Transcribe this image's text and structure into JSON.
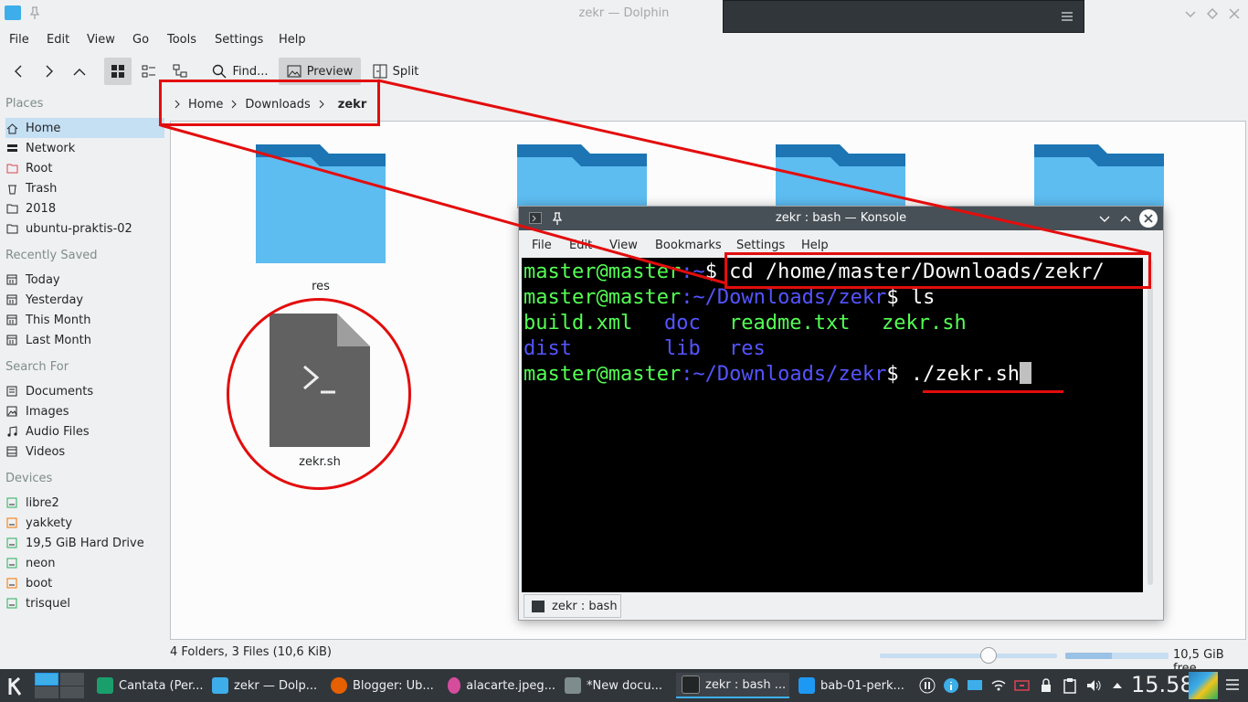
{
  "window": {
    "title": "zekr — Dolphin"
  },
  "menu": [
    "File",
    "Edit",
    "View",
    "Go",
    "Tools",
    "Settings",
    "Help"
  ],
  "toolbar": {
    "find": "Find...",
    "preview": "Preview",
    "split": "Split"
  },
  "breadcrumb": [
    "Home",
    "Downloads",
    "zekr"
  ],
  "places": {
    "header": "Places",
    "items": [
      "Home",
      "Network",
      "Root",
      "Trash",
      "2018",
      "ubuntu-praktis-02"
    ],
    "recent_header": "Recently Saved",
    "recent": [
      "Today",
      "Yesterday",
      "This Month",
      "Last Month"
    ],
    "search_header": "Search For",
    "search": [
      "Documents",
      "Images",
      "Audio Files",
      "Videos"
    ],
    "devices_header": "Devices",
    "devices": [
      "libre2",
      "yakkety",
      "19,5 GiB Hard Drive",
      "neon",
      "boot",
      "trisquel"
    ]
  },
  "files": {
    "res": "res",
    "zekr": "zekr.sh"
  },
  "status": {
    "summary": "4 Folders, 3 Files (10,6 KiB)",
    "free": "10,5 GiB free"
  },
  "konsole": {
    "title": "zekr : bash — Konsole",
    "menu": [
      "File",
      "Edit",
      "View",
      "Bookmarks",
      "Settings",
      "Help"
    ],
    "prompt_user": "master@master",
    "line1_path": ":~",
    "line1_cmd": "$ cd /home/master/Downloads/zekr/",
    "line2_path": ":~/Downloads/zekr",
    "line2_cmd": "$ ls",
    "ls_row1": [
      "build.xml",
      "doc",
      "readme.txt",
      "zekr.sh"
    ],
    "ls_row2": [
      "dist",
      "lib",
      "res"
    ],
    "line3_path": ":~/Downloads/zekr",
    "line3_cmd": "$ ./zekr.sh",
    "tab": "zekr : bash"
  },
  "taskbar": {
    "tasks": [
      "Cantata (Per...",
      "zekr — Dolp...",
      "Blogger: Ub...",
      "alacarte.jpeg...",
      "*New docu...",
      "zekr : bash ...",
      "bab-01-perk..."
    ],
    "clock": "15.58"
  },
  "colors": {
    "annotation": "#e30d0d",
    "folder": "#5dbcf0",
    "term_green": "#54ff54",
    "term_blue": "#5454ff"
  }
}
